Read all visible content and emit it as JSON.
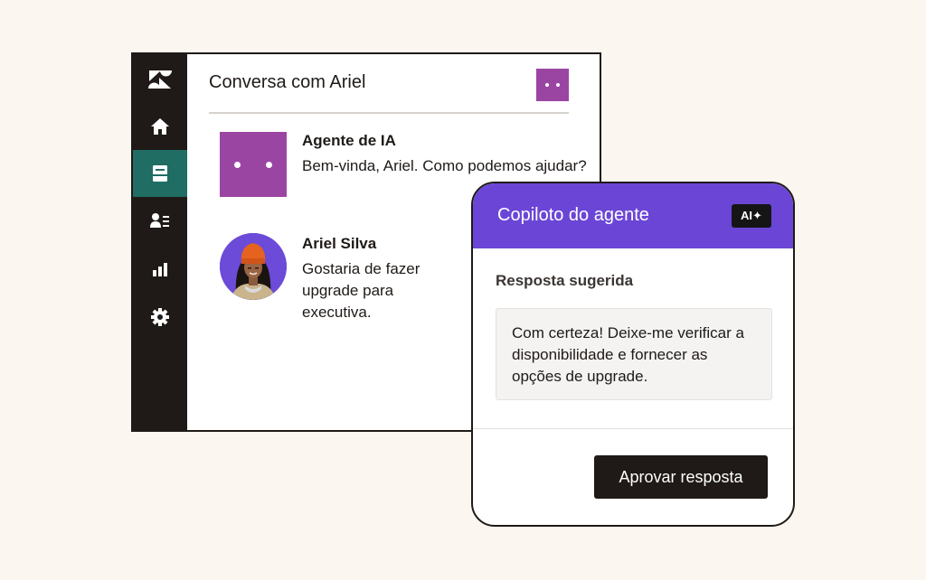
{
  "conversation": {
    "title": "Conversa com Ariel"
  },
  "sidebar": {
    "items": [
      {
        "icon": "zendesk-logo-icon",
        "active": false
      },
      {
        "icon": "home-icon",
        "active": false
      },
      {
        "icon": "inbox-icon",
        "active": true
      },
      {
        "icon": "contacts-icon",
        "active": false
      },
      {
        "icon": "bar-chart-icon",
        "active": false
      },
      {
        "icon": "gear-icon",
        "active": false
      }
    ]
  },
  "messages": [
    {
      "sender": "Agente de IA",
      "text": "Bem-vinda, Ariel. Como podemos ajudar?",
      "avatar": "bot-avatar"
    },
    {
      "sender": "Ariel Silva",
      "text": "Gostaria de fazer upgrade para executiva.",
      "avatar": "user-photo-avatar"
    }
  ],
  "copilot": {
    "title": "Copiloto do agente",
    "badge": "AI✦",
    "section_label": "Resposta sugerida",
    "suggestion": "Com certeza! Deixe-me verificar a disponibilidade e fornecer as opções de upgrade.",
    "approve_label": "Aprovar resposta"
  },
  "colors": {
    "background": "#fbf6ef",
    "sidebar": "#1f1a17",
    "sidebar_active": "#1f6d63",
    "bot_purple": "#9b45a3",
    "copilot_purple": "#6b46d6",
    "button_dark": "#1f1a17"
  }
}
